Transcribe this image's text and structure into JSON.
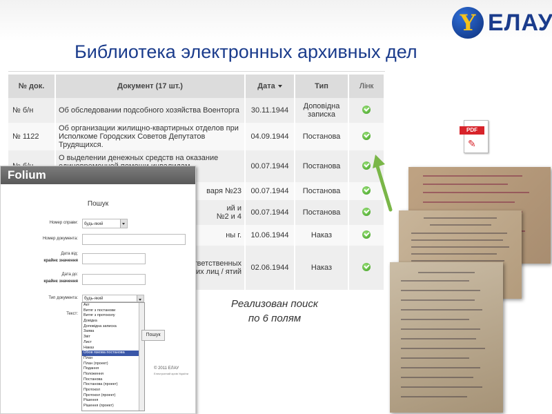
{
  "logo": {
    "mark": "Y",
    "text": "ЕЛАУ"
  },
  "title": "Библиотека электронных архивных дел",
  "table": {
    "headers": {
      "num": "№ док.",
      "doc": "Документ (17 шт.)",
      "date": "Дата",
      "type": "Тип",
      "link": "Лінк"
    },
    "rows": [
      {
        "num": "№ б/н",
        "doc1": "Об обследовании подсобного хозяйства Военторга",
        "doc2": "",
        "date": "30.11.1944",
        "type1": "Доповідна",
        "type2": "записка"
      },
      {
        "num": "№ 1122",
        "doc1": "Об организации жилищно-квартирных отделов при",
        "doc2": "Исполкоме Городских Советов Депутатов Трудящихся.",
        "date": "04.09.1944",
        "type1": "Постанова",
        "type2": ""
      },
      {
        "num": "№ б/н",
        "doc1": "О выделении денежных средств на оказание",
        "doc2": "единовременной помощи инвалидам Отечественной",
        "date": "00.07.1944",
        "type1": "Постанова",
        "type2": ""
      },
      {
        "num": "",
        "doc1": "варя №23",
        "doc2": "",
        "date": "00.07.1944",
        "type1": "Постанова",
        "type2": ""
      },
      {
        "num": "",
        "doc1": "ий и",
        "doc2": "№2 и 4",
        "date": "00.07.1944",
        "type1": "Постанова",
        "type2": ""
      },
      {
        "num": "",
        "doc1": "ны г.",
        "doc2": "",
        "date": "10.06.1944",
        "type1": "Наказ",
        "type2": ""
      },
      {
        "num": "",
        "doc1": "тветственных",
        "doc2": "гих лиц / ятий",
        "date": "02.06.1944",
        "type1": "Наказ",
        "type2": ""
      }
    ]
  },
  "folium": {
    "brand": "Folium",
    "heading": "Пошук",
    "case_label": "Номер справи:",
    "case_value": "будь-який",
    "docnum_label": "Номер документа:",
    "date_from_label": "Дата від:",
    "date_from_sub": "крайнє значення",
    "date_to_label": "Дата до:",
    "date_to_sub": "крайнє значення",
    "doctype_label": "Тип документа:",
    "doctype_value": "будь-який",
    "text_label": "Текст:",
    "search_button": "Пошук",
    "doctype_options": [
      "Акт",
      "Витяг з постанови",
      "Витяг з протоколу",
      "Довідка",
      "Доповідна записка",
      "Заява",
      "Звіт",
      "Лист",
      "Наказ",
      "Обов язкова постанова",
      "План",
      "План (проект)",
      "Подання",
      "Положення",
      "Постанова",
      "Постанова (проект)",
      "Протокол",
      "Протокол (проект)",
      "Рішення",
      "Рішення (проект)"
    ],
    "highlight_index": 9,
    "copyright": "© 2011 ЕЛАУ",
    "copyright_sub": "Електронний архів України"
  },
  "pdf": {
    "label": "PDF"
  },
  "caption": {
    "line1": "Реализован поиск",
    "line2": "по 6 полям"
  },
  "colors": {
    "title": "#1b3c8c",
    "pdf": "#d7232a",
    "arrow": "#7ab648",
    "highlight": "#3a57a8"
  }
}
